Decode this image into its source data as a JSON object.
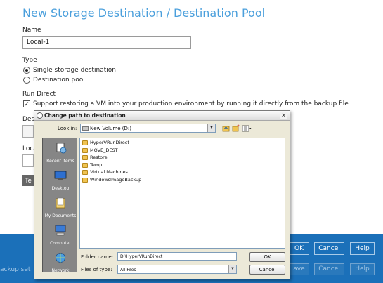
{
  "page": {
    "title": "New Storage Destination / Destination Pool",
    "name_label": "Name",
    "name_value": "Local-1",
    "type_label": "Type",
    "type_options": [
      "Single storage destination",
      "Destination pool"
    ],
    "type_selected": "Single storage destination",
    "run_direct_label": "Run Direct",
    "run_direct_checkbox": "Support restoring a VM into your production environment by running it directly from the backup file",
    "run_direct_checked": true,
    "destination_label_partial": "Des",
    "local_label_partial": "Loca",
    "test_button_partial": "Te"
  },
  "footer": {
    "ok": "OK",
    "cancel": "Cancel",
    "help": "Help",
    "backup_set_partial": "ackup set",
    "save_partial": "ave",
    "cancel2": "Cancel",
    "help2": "Help",
    "background_color": "#1b70b9"
  },
  "dialog": {
    "title": "Change path to destination",
    "look_in_label": "Look in:",
    "look_in_value": "New Volume (D:)",
    "places": [
      "Recent Items",
      "Desktop",
      "My Documents",
      "Computer",
      "Network"
    ],
    "folders": [
      "HyperVRunDirect",
      "MOVE_DEST",
      "Restore",
      "Temp",
      "Virtual Machines",
      "WindowsImageBackup"
    ],
    "folder_name_label": "Folder name:",
    "folder_name_value": "D:\\HyperVRunDirect",
    "files_of_type_label": "Files of type:",
    "files_of_type_value": "All Files",
    "ok": "OK",
    "cancel": "Cancel"
  },
  "icons": {
    "folder_color": "#f0c453",
    "accent": "#4a9fdc"
  }
}
